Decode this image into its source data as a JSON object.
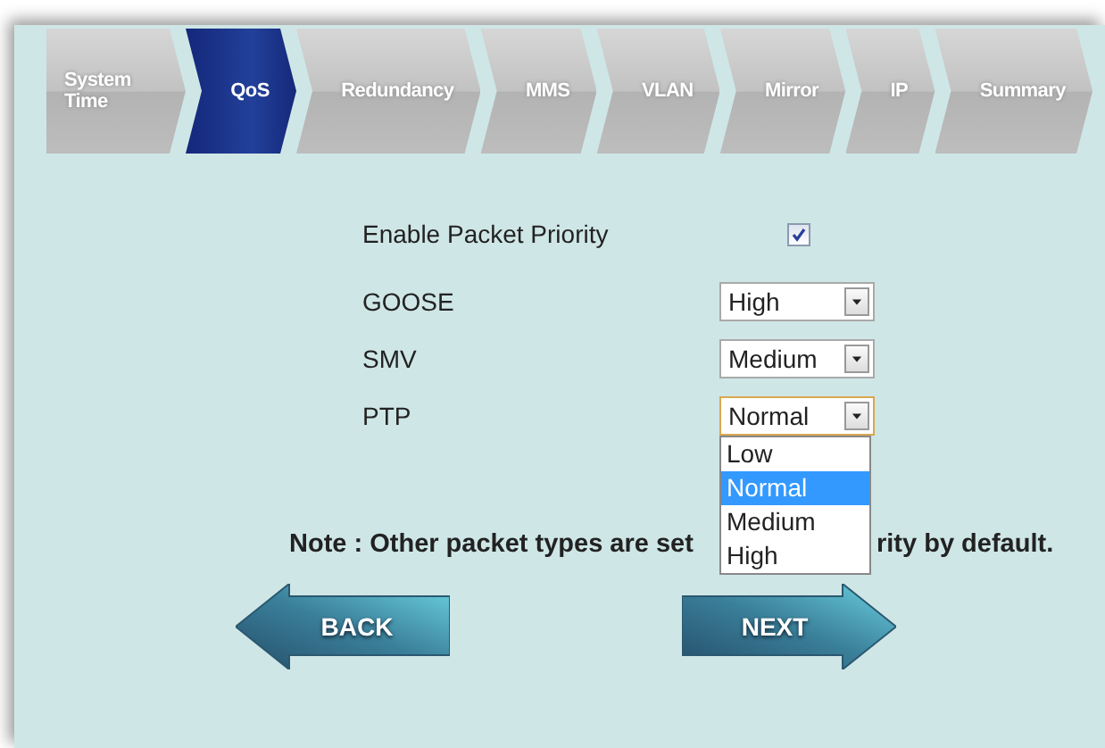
{
  "steps": [
    {
      "label": "System Time",
      "selected": false
    },
    {
      "label": "QoS",
      "selected": true
    },
    {
      "label": "Redundancy",
      "selected": false
    },
    {
      "label": "MMS",
      "selected": false
    },
    {
      "label": "VLAN",
      "selected": false
    },
    {
      "label": "Mirror",
      "selected": false
    },
    {
      "label": "IP",
      "selected": false
    },
    {
      "label": "Summary",
      "selected": false
    }
  ],
  "enable": {
    "label": "Enable Packet Priority",
    "checked": true
  },
  "priorities": [
    {
      "name": "GOOSE",
      "value": "High",
      "focused": false
    },
    {
      "name": "SMV",
      "value": "Medium",
      "focused": false
    },
    {
      "name": "PTP",
      "value": "Normal",
      "focused": true,
      "options": [
        {
          "label": "Low",
          "selected": false
        },
        {
          "label": "Normal",
          "selected": true
        },
        {
          "label": "Medium",
          "selected": false
        },
        {
          "label": "High",
          "selected": false
        }
      ]
    }
  ],
  "note": {
    "before": "Note : Other packet types are set",
    "after": "rity by default."
  },
  "buttons": [
    {
      "label": "BACK",
      "kind": "back"
    },
    {
      "label": "NEXT",
      "kind": "next"
    }
  ]
}
